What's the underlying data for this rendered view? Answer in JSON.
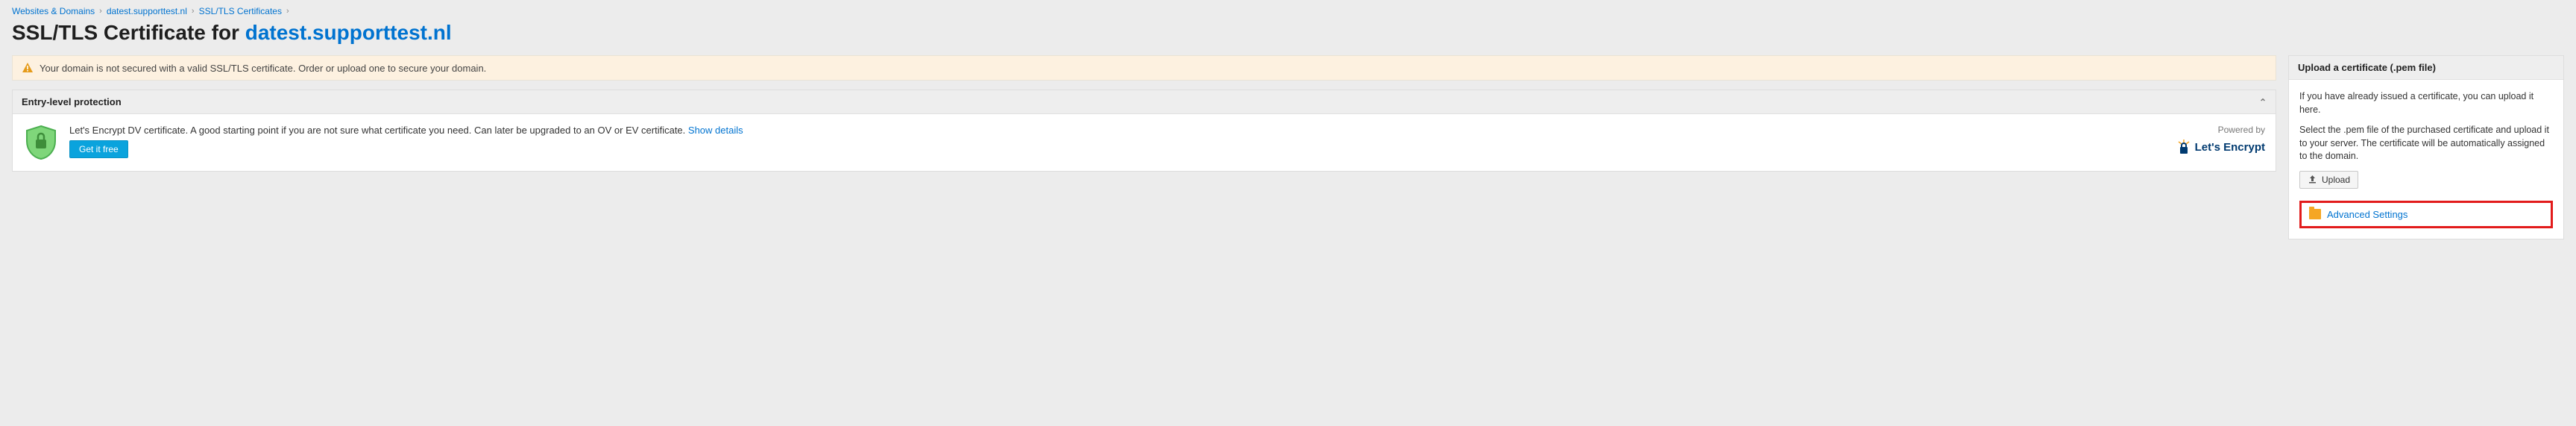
{
  "breadcrumb": {
    "items": [
      "Websites & Domains",
      "datest.supporttest.nl",
      "SSL/TLS Certificates"
    ]
  },
  "title": {
    "prefix": "SSL/TLS Certificate for ",
    "domain": "datest.supporttest.nl"
  },
  "alert": {
    "text": "Your domain is not secured with a valid SSL/TLS certificate. Order or upload one to secure your domain."
  },
  "entry_panel": {
    "header": "Entry-level protection",
    "description": "Let's Encrypt DV certificate. A good starting point if you are not sure what certificate you need. Can later be upgraded to an OV or EV certificate.",
    "show_details": "Show details",
    "get_button": "Get it free",
    "powered_by_label": "Powered by",
    "provider": "Let's Encrypt"
  },
  "upload_panel": {
    "header": "Upload a certificate (.pem file)",
    "p1": "If you have already issued a certificate, you can upload it here.",
    "p2": "Select the .pem file of the purchased certificate and upload it to your server. The certificate will be automatically assigned to the domain.",
    "upload_button": "Upload"
  },
  "advanced": {
    "label": "Advanced Settings"
  }
}
